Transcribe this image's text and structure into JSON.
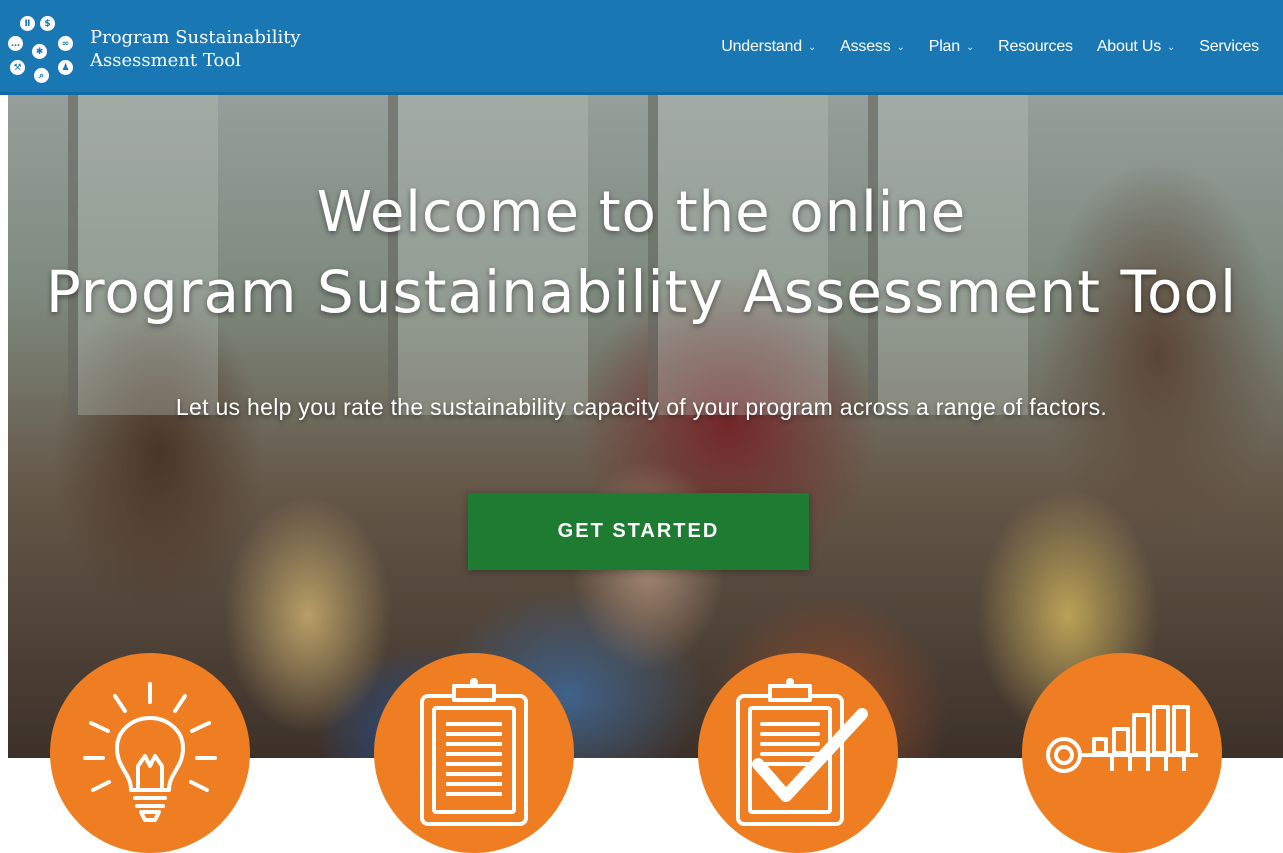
{
  "header": {
    "brand_line1": "Program Sustainability",
    "brand_line2": "Assessment Tool",
    "logo_icons": [
      "pillar-icon",
      "dollar-icon",
      "chat-icon",
      "gear-icon",
      "handshake-icon",
      "wrench-icon",
      "magnifier-icon",
      "people-icon"
    ],
    "colors": {
      "bar": "#1977b4"
    }
  },
  "nav": {
    "items": [
      {
        "label": "Understand",
        "has_dropdown": true
      },
      {
        "label": "Assess",
        "has_dropdown": true
      },
      {
        "label": "Plan",
        "has_dropdown": true
      },
      {
        "label": "Resources",
        "has_dropdown": false
      },
      {
        "label": "About Us",
        "has_dropdown": true
      },
      {
        "label": "Services",
        "has_dropdown": false
      }
    ],
    "chevron": "⌄"
  },
  "hero": {
    "title_line1": "Welcome to the online",
    "title_line2": "Program Sustainability Assessment Tool",
    "subtitle": "Let us help you rate the sustainability capacity of your program across a range of factors.",
    "cta_label": "GET STARTED",
    "colors": {
      "cta": "#1e7c32"
    }
  },
  "features": {
    "icons": [
      "lightbulb-icon",
      "clipboard-icon",
      "clipboard-check-icon",
      "key-chart-icon"
    ],
    "colors": {
      "circle": "#ef7d22"
    }
  }
}
